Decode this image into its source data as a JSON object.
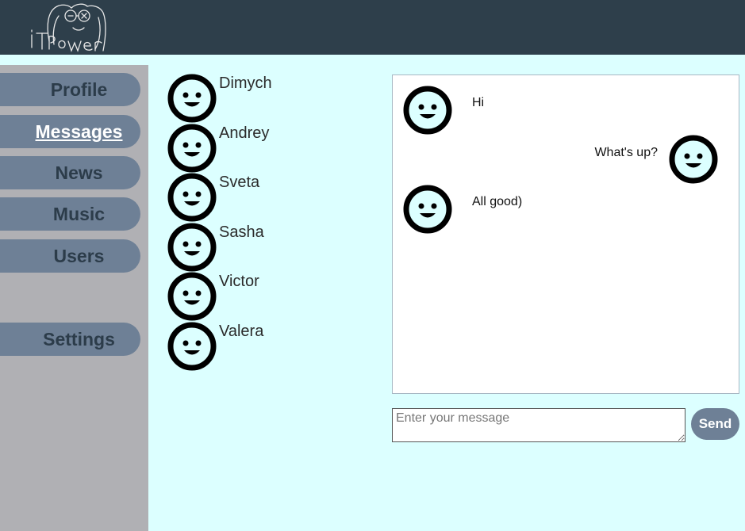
{
  "nav": {
    "items": [
      {
        "label": "Profile",
        "active": false
      },
      {
        "label": "Messages",
        "active": true
      },
      {
        "label": "News",
        "active": false
      },
      {
        "label": "Music",
        "active": false
      },
      {
        "label": "Users",
        "active": false
      }
    ],
    "settings_label": "Settings"
  },
  "dialogs": [
    {
      "name": "Dimych"
    },
    {
      "name": "Andrey"
    },
    {
      "name": "Sveta"
    },
    {
      "name": "Sasha"
    },
    {
      "name": "Victor"
    },
    {
      "name": "Valera"
    }
  ],
  "messages": [
    {
      "text": "Hi",
      "side": "left"
    },
    {
      "text": "What's up?",
      "side": "right"
    },
    {
      "text": "All good)",
      "side": "left"
    }
  ],
  "composer": {
    "placeholder": "Enter your message",
    "value": "",
    "send_label": "Send"
  },
  "colors": {
    "header": "#2e3f4b",
    "sidebar": "#b0b0b4",
    "nav_button": "#6e8096",
    "page_background": "#dcffff"
  },
  "icons": {
    "logo": "it-power-logo",
    "avatar": "smiley-face-icon"
  }
}
